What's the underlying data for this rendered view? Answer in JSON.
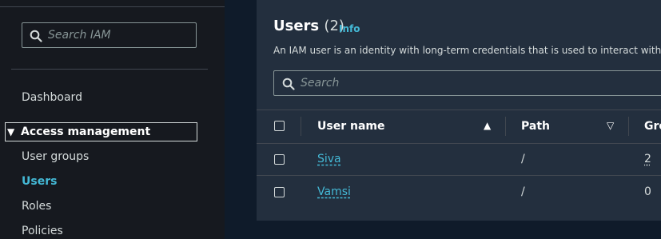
{
  "sidebar": {
    "search_placeholder": "Search IAM",
    "dashboard": "Dashboard",
    "section_title": "Access management",
    "items": [
      {
        "label": "User groups"
      },
      {
        "label": "Users"
      },
      {
        "label": "Roles"
      },
      {
        "label": "Policies"
      }
    ]
  },
  "main": {
    "title": "Users",
    "count": "(2)",
    "info": "Info",
    "description": "An IAM user is an identity with long-term credentials that is used to interact with AWS i",
    "search_placeholder": "Search",
    "columns": {
      "username": "User name",
      "path": "Path",
      "groups": "Gro"
    },
    "rows": [
      {
        "username": "Siva",
        "path": "/",
        "groups": "2"
      },
      {
        "username": "Vamsi",
        "path": "/",
        "groups": "0"
      }
    ]
  },
  "colors": {
    "accent": "#44b9d6",
    "sidebar_bg": "#16191f",
    "page_bg": "#0f1b2a",
    "panel_bg": "#232f3e"
  }
}
